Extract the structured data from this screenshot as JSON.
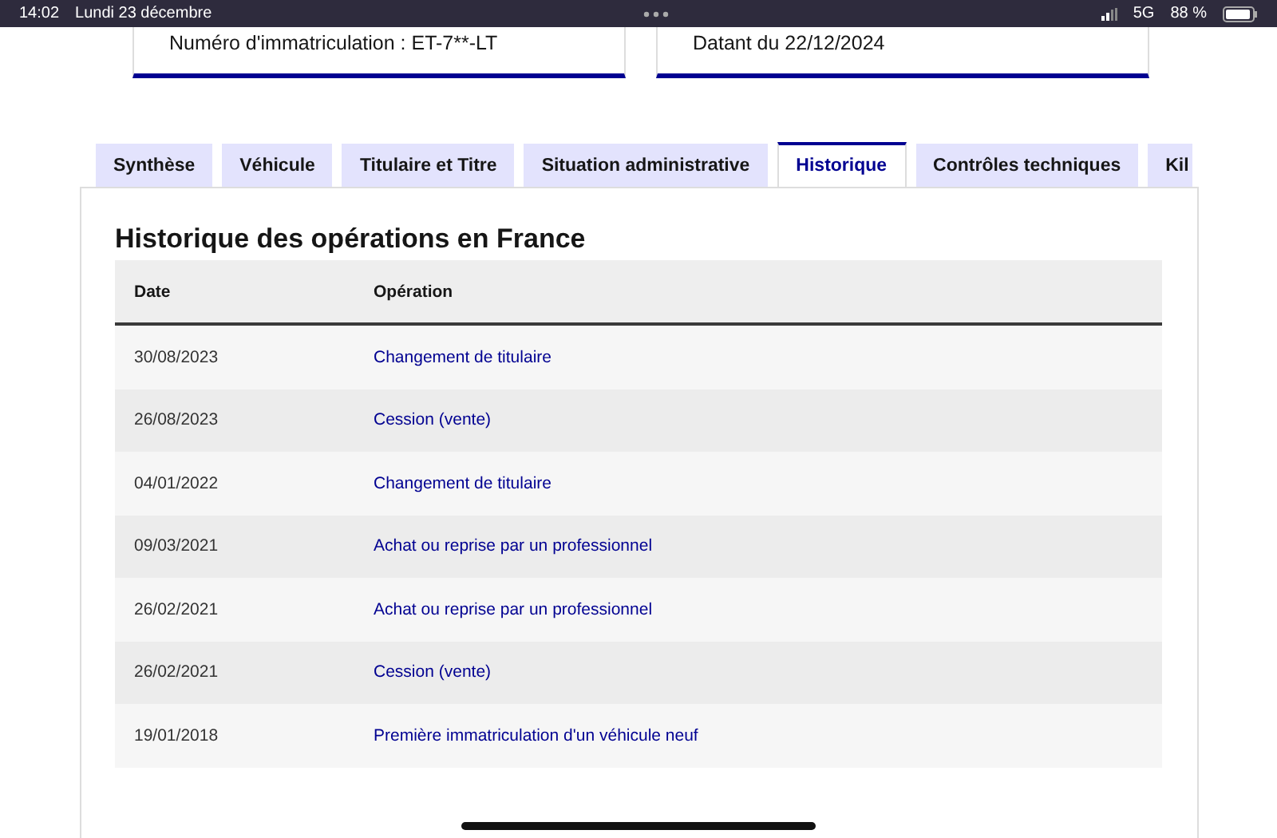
{
  "status_bar": {
    "time": "14:02",
    "date": "Lundi 23 décembre",
    "network": "5G",
    "battery": "88 %"
  },
  "cards": [
    {
      "text": "Numéro d'immatriculation : ET-7**-LT"
    },
    {
      "text": "Datant du 22/12/2024"
    }
  ],
  "tabs": [
    {
      "label": "Synthèse",
      "selected": false
    },
    {
      "label": "Véhicule",
      "selected": false
    },
    {
      "label": "Titulaire et Titre",
      "selected": false
    },
    {
      "label": "Situation administrative",
      "selected": false
    },
    {
      "label": "Historique",
      "selected": true
    },
    {
      "label": "Contrôles techniques",
      "selected": false
    },
    {
      "label": "Kil",
      "selected": false
    }
  ],
  "section_title": "Historique des opérations en France",
  "table": {
    "columns": [
      "Date",
      "Opération"
    ],
    "rows": [
      [
        "30/08/2023",
        "Changement de titulaire"
      ],
      [
        "26/08/2023",
        "Cession (vente)"
      ],
      [
        "04/01/2022",
        "Changement de titulaire"
      ],
      [
        "09/03/2021",
        "Achat ou reprise par un professionnel"
      ],
      [
        "26/02/2021",
        "Achat ou reprise par un professionnel"
      ],
      [
        "26/02/2021",
        "Cession (vente)"
      ],
      [
        "19/01/2018",
        "Première immatriculation d'un véhicule neuf"
      ]
    ]
  }
}
